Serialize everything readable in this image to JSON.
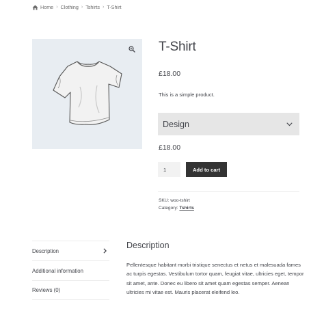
{
  "breadcrumb": {
    "home": "Home",
    "clothing": "Clothing",
    "tshirts": "Tshirts",
    "current": "T-Shirt",
    "separator": "›"
  },
  "product": {
    "title": "T-Shirt",
    "price": "£18.00",
    "short_description": "This is a simple product.",
    "variation_select_value": "Design",
    "variation_price": "£18.00",
    "quantity": "1",
    "add_to_cart_label": "Add to cart",
    "sku_label": "SKU:",
    "sku_value": "woo-tshirt",
    "category_label": "Category:",
    "category_value": "Tshirts",
    "image_icon": "tshirt-image"
  },
  "tabs": [
    {
      "label": "Description",
      "active": true
    },
    {
      "label": "Additional information",
      "active": false
    },
    {
      "label": "Reviews (0)",
      "active": false
    }
  ],
  "panel": {
    "title": "Description",
    "text": "Pellentesque habitant morbi tristique senectus et netus et malesuada fames ac turpis egestas. Vestibulum tortor quam, feugiat vitae, ultricies eget, tempor sit amet, ante. Donec eu libero sit amet quam egestas semper. Aenean ultricies mi vitae est. Mauris placerat eleifend leo."
  },
  "colors": {
    "image_background": "#e8edf2",
    "button_background": "#333333",
    "select_background": "#e6e6e6",
    "text": "#43454b"
  }
}
